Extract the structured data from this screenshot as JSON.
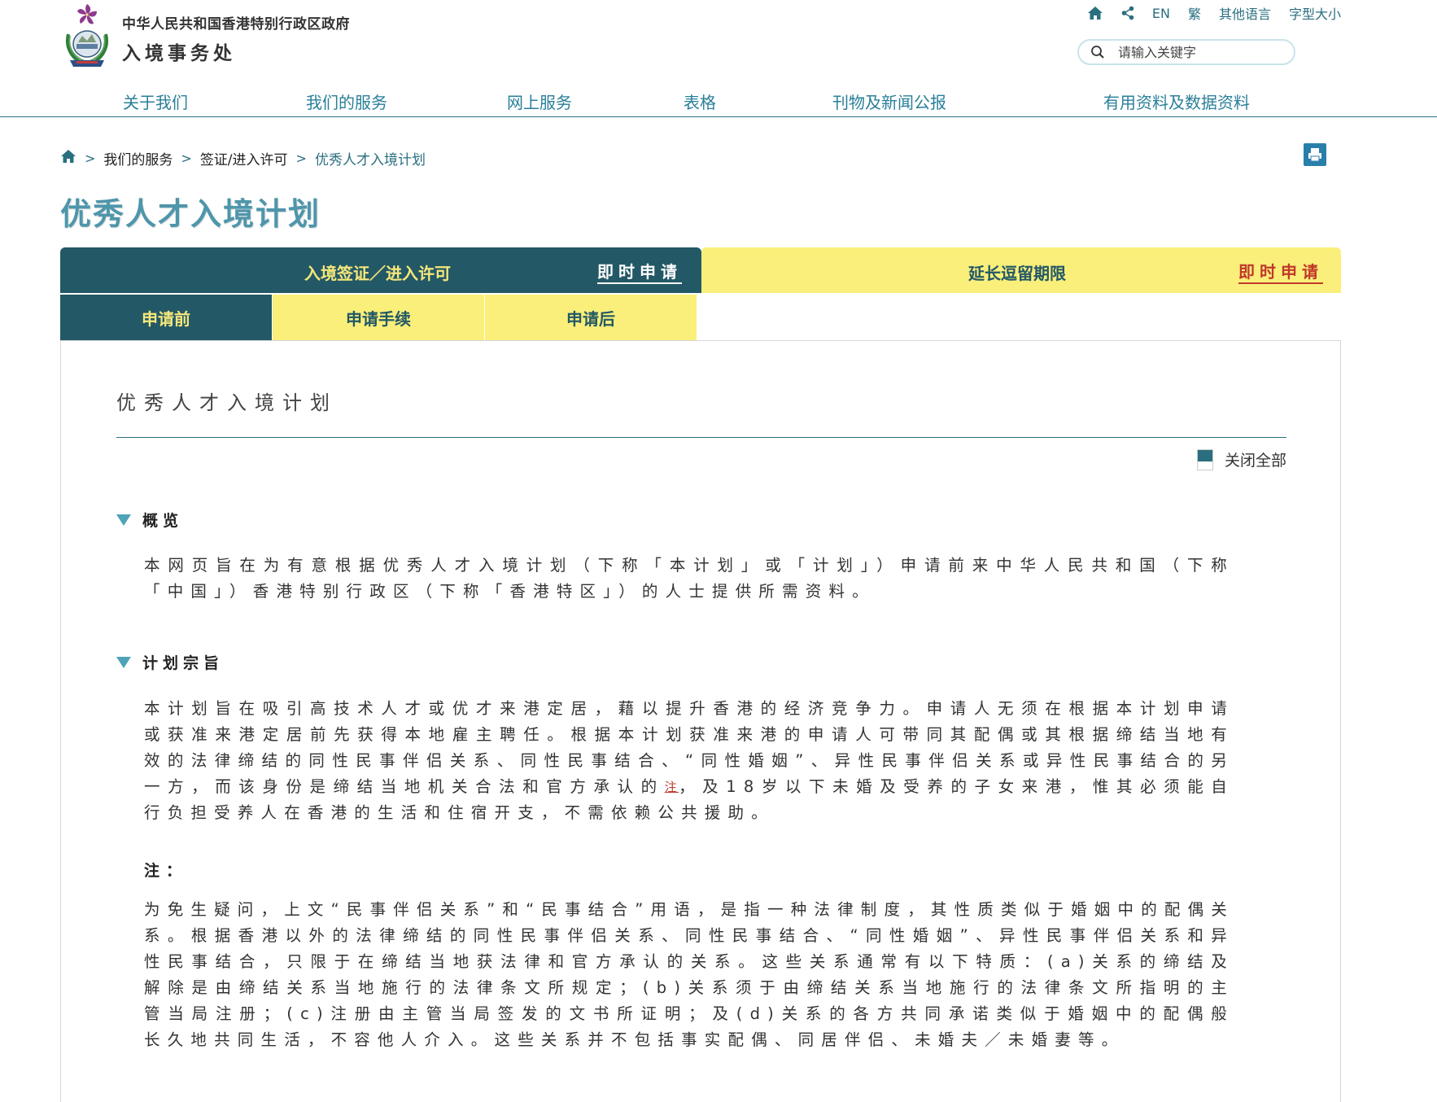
{
  "header": {
    "org_line1": "中华人民共和国香港特别行政区政府",
    "org_line2": "入境事务处",
    "toolbar": {
      "home_icon": "home-icon",
      "share_icon": "share-icon",
      "lang_en": "EN",
      "lang_tc": "繁",
      "other_languages": "其他语言",
      "font_size": "字型大小"
    },
    "search": {
      "placeholder": "请输入关键字"
    }
  },
  "nav": {
    "items": [
      {
        "label": "关于我们"
      },
      {
        "label": "我们的服务"
      },
      {
        "label": "网上服务"
      },
      {
        "label": "表格"
      },
      {
        "label": "刊物及新闻公报"
      },
      {
        "label": "有用资料及数据资料"
      }
    ]
  },
  "breadcrumb": {
    "items": [
      {
        "label": "我们的服务"
      },
      {
        "label": "签证/进入许可"
      },
      {
        "label": "优秀人才入境计划"
      }
    ],
    "separator": ">"
  },
  "page": {
    "title": "优秀人才入境计划"
  },
  "tabs": {
    "left": {
      "label": "入境签证／进入许可",
      "apply": "即时申请"
    },
    "right": {
      "label": "延长逗留期限",
      "apply": "即时申请"
    },
    "sub": [
      {
        "label": "申请前",
        "active": true
      },
      {
        "label": "申请手续",
        "active": false
      },
      {
        "label": "申请后",
        "active": false
      }
    ]
  },
  "content": {
    "section_title": "优秀人才入境计划",
    "close_all": "关闭全部",
    "overview": {
      "heading": "概览",
      "text": "本网页旨在为有意根据优秀人才入境计划（下称「本计划」或「计划」）申请前来中华人民共和国（下称「中国」）香港特别行政区（下称「香港特区」）的人士提供所需资料。"
    },
    "objective": {
      "heading": "计划宗旨",
      "text_before": "本计划旨在吸引高技术人才或优才来港定居，藉以提升香港的经济竞争力。申请人无须在根据本计划申请或获准来港定居前先获得本地雇主聘任。根据本计划获准来港的申请人可带同其配偶或其根据缔结当地有效的法律缔结的同性民事伴侣关系、同性民事结合、“同性婚姻”、异性民事伴侣关系或异性民事结合的另一方，而该身份是缔结当地机关合法和官方承认的",
      "note_ref": "注",
      "text_after": "，及18岁以下未婚及受养的子女来港，惟其必须能自行负担受养人在香港的生活和住宿开支，不需依赖公共援助。"
    },
    "note": {
      "heading": "注：",
      "text": "为免生疑问，上文“民事伴侣关系”和“民事结合”用语，是指一种法律制度，其性质类似于婚姻中的配偶关系。根据香港以外的法律缔结的同性民事伴侣关系、同性民事结合、“同性婚姻”、异性民事伴侣关系和异性民事结合，只限于在缔结当地获法律和官方承认的关系。这些关系通常有以下特质：(a)关系的缔结及解除是由缔结关系当地施行的法律条文所规定；(b)关系须于由缔结关系当地施行的法律条文所指明的主管当局注册；(c)注册由主管当局签发的文书所证明；及(d)关系的各方共同承诺类似于婚姻中的配偶般长久地共同生活，不容他人介入。这些关系并不包括事实配偶、同居伴侣、未婚夫／未婚妻等。"
    }
  },
  "colors": {
    "teal_dark": "#235866",
    "teal_text": "#2a6f80",
    "yellow": "#f9ef7a",
    "title_blue": "#4e96ab",
    "accent_red": "#c0392b"
  }
}
